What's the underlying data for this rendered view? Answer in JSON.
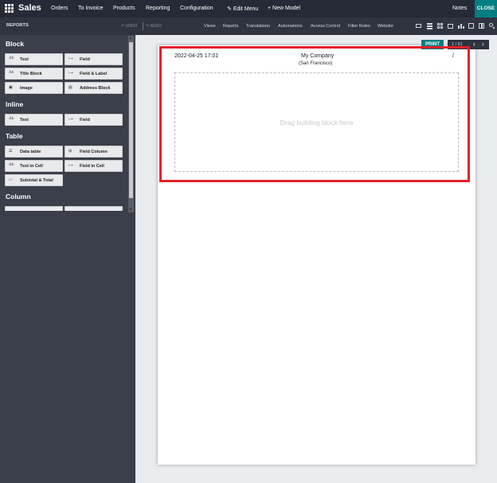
{
  "topbar": {
    "app_name": "Sales",
    "menu": [
      "Orders",
      "To Invoice",
      "Products",
      "Reporting",
      "Configuration"
    ],
    "edit_menu": "Edit Menu",
    "new_model": "New Model",
    "notes": "Notes",
    "close": "CLOSE",
    "close_color": "#017e84"
  },
  "subbar": {
    "title": "REPORTS",
    "undo": "UNDO",
    "redo": "REDO",
    "links": [
      "Views",
      "Reports",
      "Translations",
      "Automations",
      "Access Control",
      "Filter Rules",
      "Website"
    ],
    "view_icons": [
      "form-view-icon",
      "list-view-icon",
      "kanban-view-icon",
      "calendar-view-icon",
      "graph-view-icon",
      "pivot-view-icon",
      "grid-view-icon",
      "search-icon"
    ]
  },
  "sidebar": {
    "sections": {
      "block": "Block",
      "inline": "Inline",
      "table": "Table",
      "column": "Column"
    },
    "block_items": [
      "Text",
      "Field",
      "Title Block",
      "Field & Label",
      "Image",
      "Address Block"
    ],
    "inline_items": [
      "Text",
      "Field"
    ],
    "table_items": [
      "Data table",
      "Field Column",
      "Text in Cell",
      "Field in Cell",
      "Subtotal & Total"
    ]
  },
  "canvas": {
    "print": "PRINT",
    "pager": "1 / 61",
    "header_date": "2022-04-25 17:01",
    "company": "My Company",
    "city": "(San Francisco)",
    "slash": "/",
    "dropzone": "Drag building block here",
    "highlight_color": "#e6202a"
  }
}
